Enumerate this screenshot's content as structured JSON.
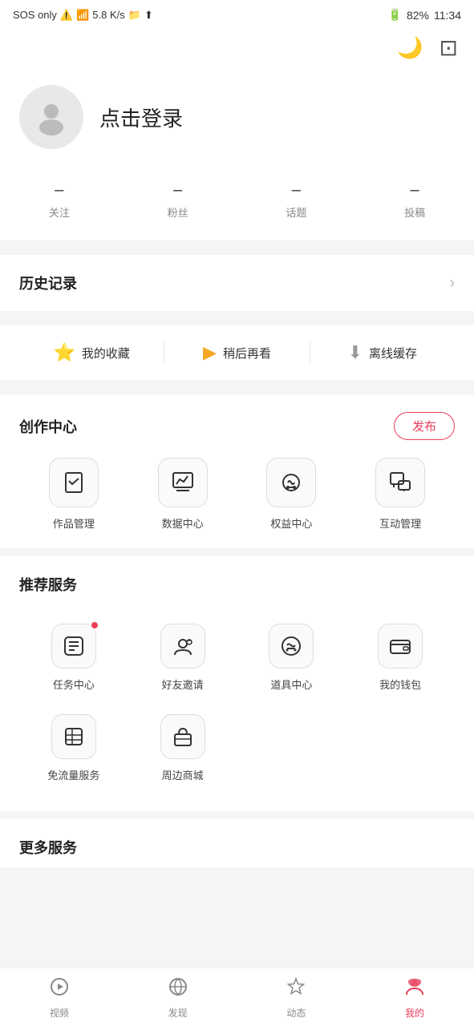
{
  "statusBar": {
    "left": "SOS only",
    "signal": "📶",
    "speed": "5.8 K/s",
    "battery": "82%",
    "time": "11:34"
  },
  "topActions": {
    "darkModeIcon": "🌙",
    "scanIcon": "⊡"
  },
  "profile": {
    "loginText": "点击登录"
  },
  "stats": [
    {
      "value": "–",
      "label": "关注"
    },
    {
      "value": "–",
      "label": "粉丝"
    },
    {
      "value": "–",
      "label": "话题"
    },
    {
      "value": "–",
      "label": "投稿"
    }
  ],
  "history": {
    "title": "历史记录"
  },
  "quickLinks": [
    {
      "label": "我的收藏",
      "color": "#e83e5a"
    },
    {
      "label": "稍后再看",
      "color": "#f5a623"
    },
    {
      "label": "离线缓存",
      "color": "#999"
    }
  ],
  "creatorSection": {
    "title": "创作中心",
    "publishLabel": "发布",
    "items": [
      {
        "label": "作品管理",
        "icon": "📋"
      },
      {
        "label": "数据中心",
        "icon": "📈"
      },
      {
        "label": "权益中心",
        "icon": "🎧"
      },
      {
        "label": "互动管理",
        "icon": "💬"
      }
    ]
  },
  "recommendedServices": {
    "title": "推荐服务",
    "items": [
      {
        "label": "任务中心",
        "icon": "🧰",
        "badge": true
      },
      {
        "label": "好友邀请",
        "icon": "😊",
        "badge": false
      },
      {
        "label": "道具中心",
        "icon": "😄",
        "badge": false
      },
      {
        "label": "我的钱包",
        "icon": "👛",
        "badge": false
      },
      {
        "label": "免流量服务",
        "icon": "📦",
        "badge": false
      },
      {
        "label": "周边商城",
        "icon": "🏠",
        "badge": false
      }
    ]
  },
  "moreSection": {
    "title": "更多服务"
  },
  "bottomNav": [
    {
      "label": "视频",
      "icon": "▶",
      "active": false
    },
    {
      "label": "发现",
      "icon": "🪐",
      "active": false
    },
    {
      "label": "动态",
      "icon": "⭐",
      "active": false
    },
    {
      "label": "我的",
      "icon": "❤",
      "active": true
    }
  ]
}
